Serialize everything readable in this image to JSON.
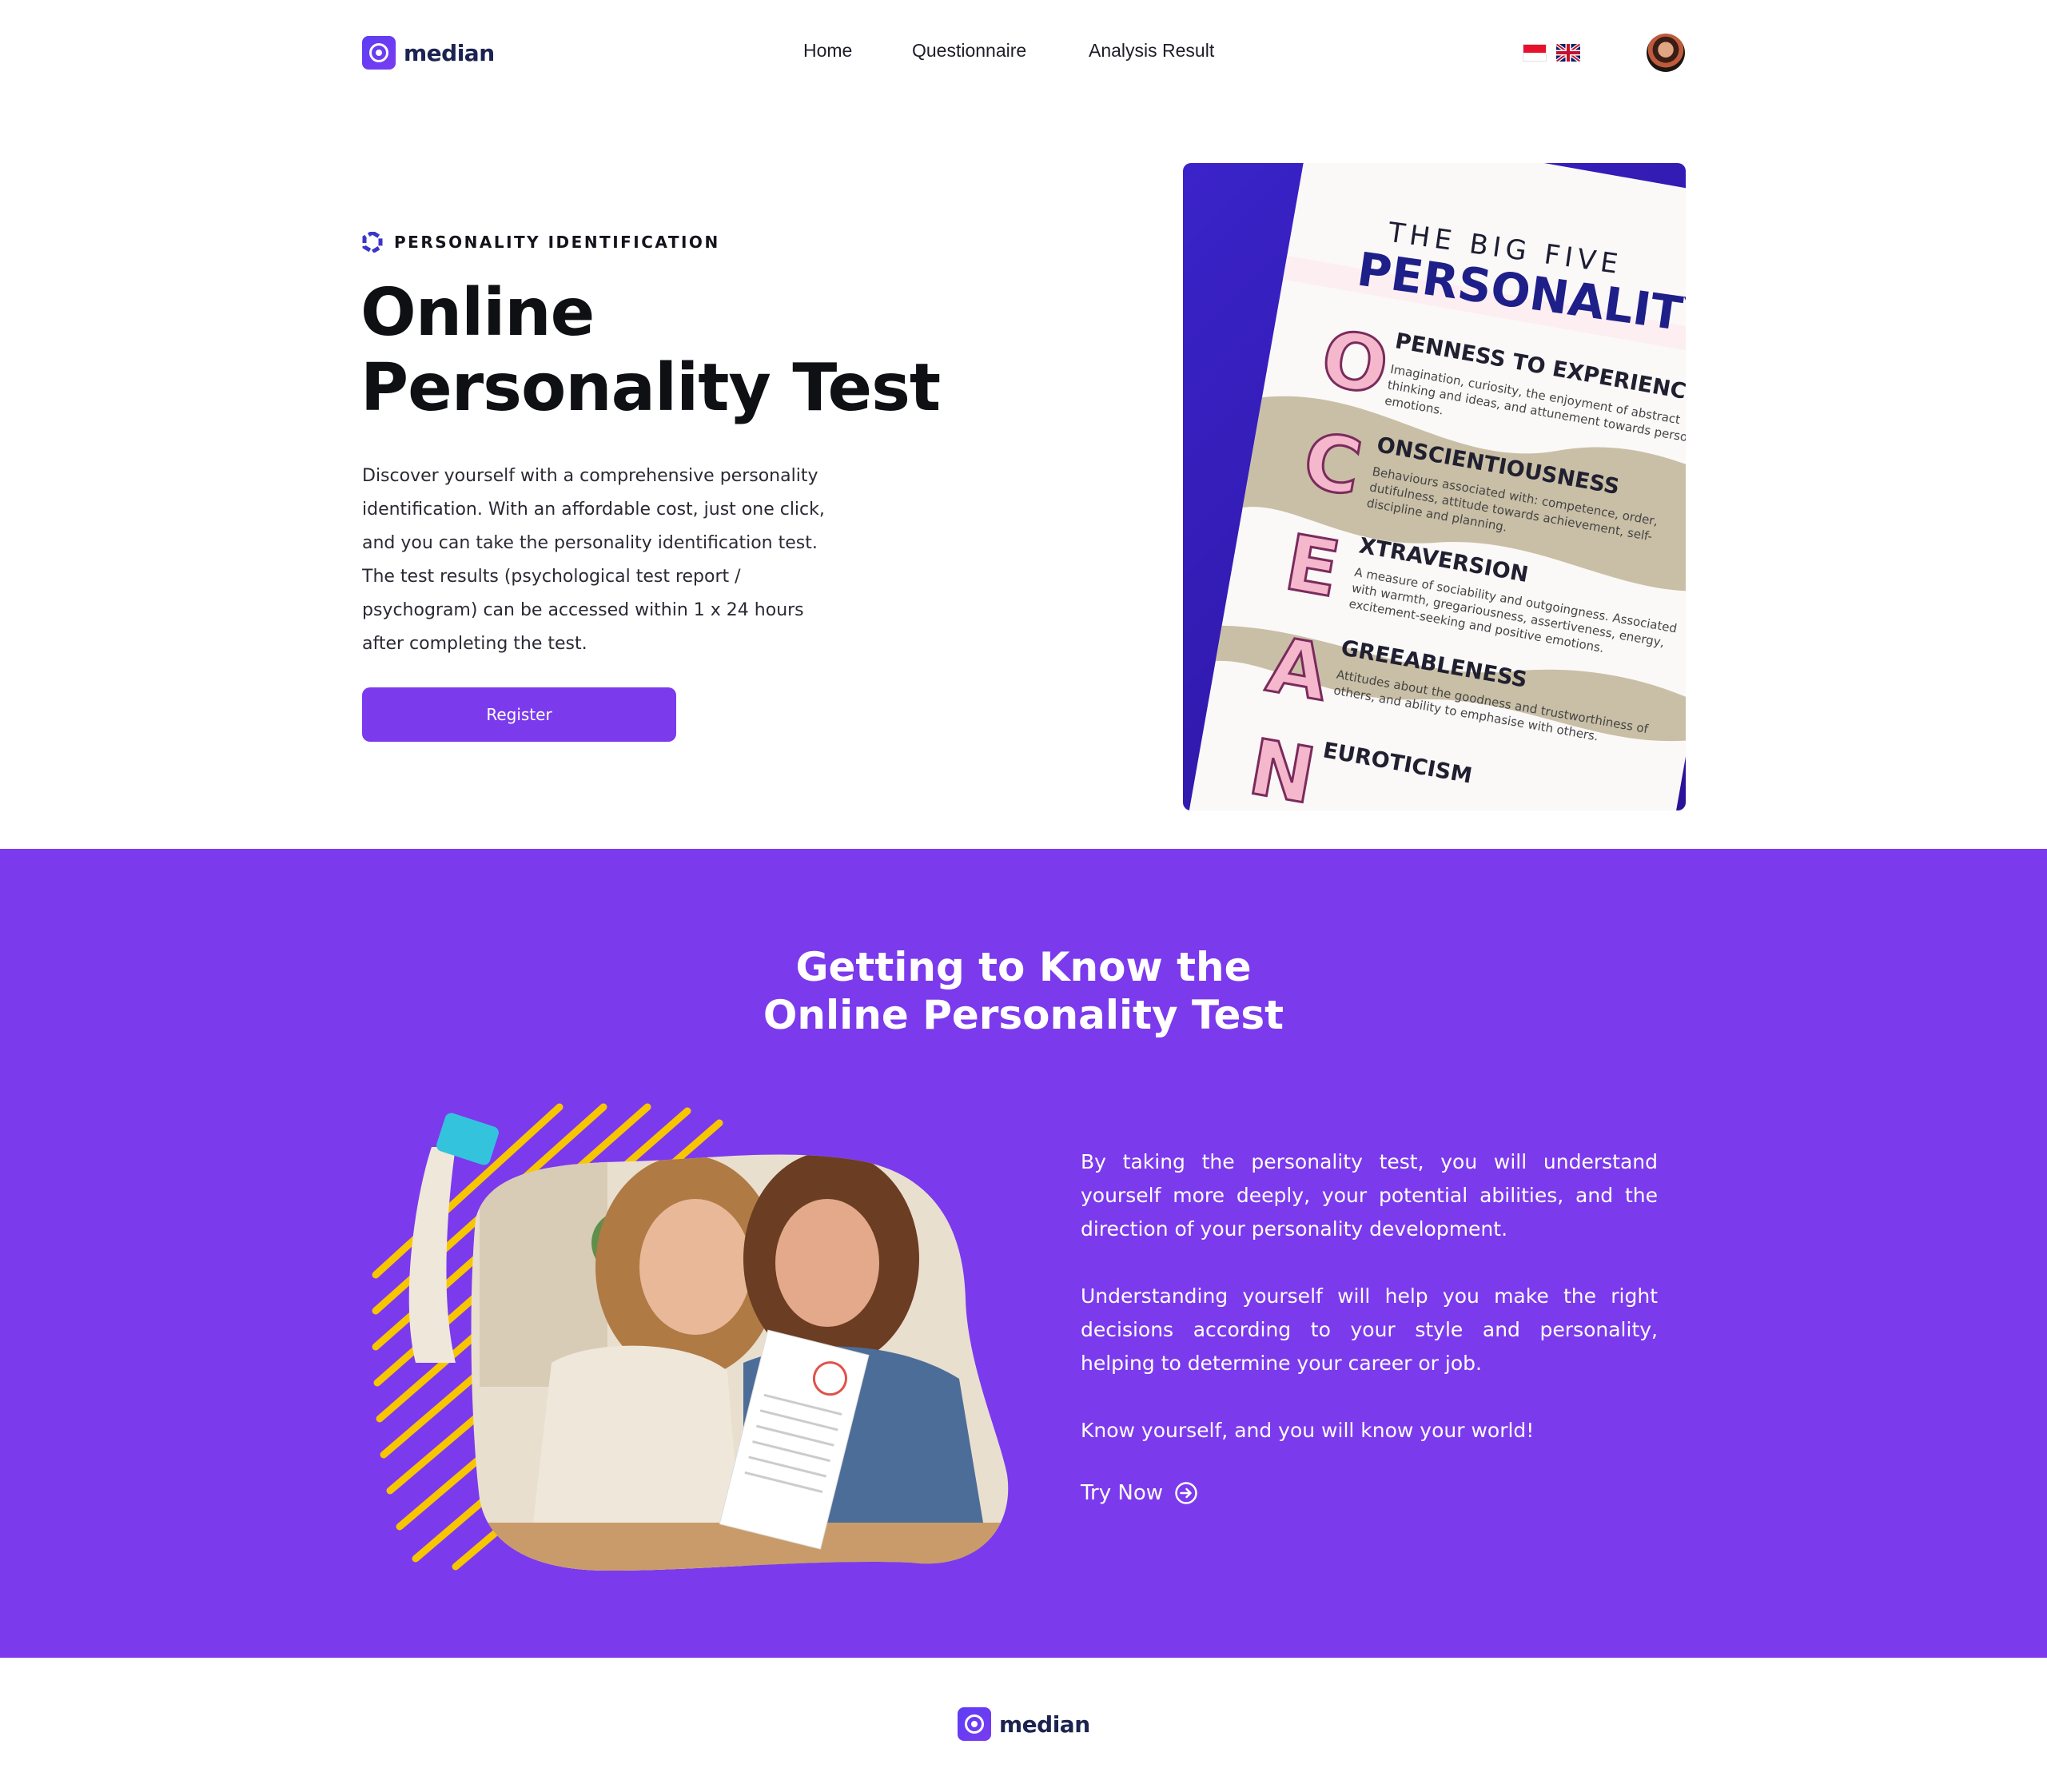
{
  "brand": {
    "name": "median",
    "primary_color": "#7c3aed",
    "dark_color": "#1b2350"
  },
  "nav": {
    "links": [
      "Home",
      "Questionnaire",
      "Analysis Result"
    ],
    "languages": [
      {
        "flag": "indonesia-flag-icon"
      },
      {
        "flag": "uk-flag-icon"
      }
    ],
    "profile_icon": "avatar"
  },
  "hero": {
    "eyebrow": "PERSONALITY IDENTIFICATION",
    "title_line1": "Online",
    "title_line2": "Personality Test",
    "description": "Discover yourself with a comprehensive personality identification. With an affordable cost, just one click, and you can take the personality identification test. The test results (psychological test report / psychogram) can be accessed within 1 x 24 hours after completing the test.",
    "register_label": "Register"
  },
  "poster": {
    "title_small": "THE BIG FIVE",
    "title_big": "PERSONALITY",
    "traits": [
      {
        "letter": "O",
        "name": "PENNESS TO EXPERIENCE",
        "desc": [
          "Imagination, curiosity, the enjoyment of abstract",
          "thinking and ideas, and attunement towards personal",
          "emotions."
        ]
      },
      {
        "letter": "C",
        "name": "ONSCIENTIOUSNESS",
        "desc": [
          "Behaviours associated with: competence, order,",
          "dutifulness, attitude towards achievement, self-",
          "discipline and planning."
        ]
      },
      {
        "letter": "E",
        "name": "XTRAVERSION",
        "desc": [
          "A measure of sociability and outgoingness. Associated",
          "with warmth, gregariousness, assertiveness, energy,",
          "excitement-seeking and positive emotions."
        ]
      },
      {
        "letter": "A",
        "name": "GREEABLENESS",
        "desc": [
          "Attitudes about the goodness and trustworthiness of",
          "others, and ability to emphasise with others."
        ]
      },
      {
        "letter": "N",
        "name": "EUROTICISM",
        "desc": []
      }
    ]
  },
  "about": {
    "title_line1": "Getting to Know the",
    "title_line2": "Online Personality Test",
    "paragraphs": [
      "By taking the personality test, you will understand yourself more deeply, your potential abilities, and the direction of your personality development.",
      "Understanding yourself will help you make the right decisions according to your style and personality, helping to determine your career or job.",
      "Know yourself, and you will know your world!"
    ],
    "cta_label": "Try Now",
    "cta_icon": "arrow-right-circle-icon"
  },
  "footer": {
    "brand": "median"
  }
}
